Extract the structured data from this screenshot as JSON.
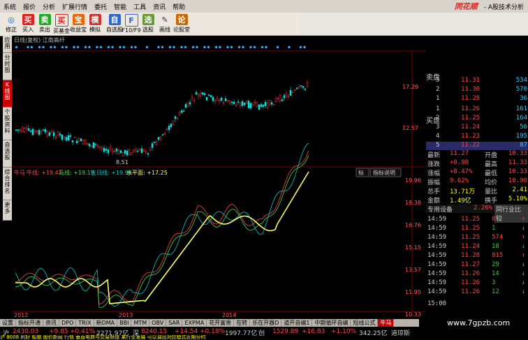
{
  "menu": {
    "items": [
      "系统",
      "报价",
      "分析",
      "扩展行情",
      "委托",
      "智能",
      "工具",
      "资讯",
      "帮助"
    ],
    "brand": "同花顺",
    "brand_sub": "- A股技术分析"
  },
  "toolbar": {
    "items": [
      {
        "label": "修正",
        "icon": "◎"
      },
      {
        "label": "买入",
        "icon": "买"
      },
      {
        "label": "卖出",
        "icon": "卖"
      },
      {
        "label": "买基金",
        "icon": "买"
      },
      {
        "label": "收益宝",
        "icon": "宝"
      },
      {
        "label": "模拟",
        "icon": "模"
      },
      {
        "label": "自选股",
        "icon": "自"
      },
      {
        "label": "F10/F9",
        "icon": "F"
      },
      {
        "label": "选股",
        "icon": "选"
      },
      {
        "label": "画线",
        "icon": "✎"
      },
      {
        "label": "论股堂",
        "icon": "论"
      }
    ]
  },
  "left_tabs": [
    "应用",
    "分时图",
    "K线图",
    "个股资料",
    "自选股",
    "综合排名",
    "更多"
  ],
  "chart": {
    "header": "日线(复权) 江南高纤",
    "price_ticks": [
      "17.29",
      "12.57"
    ],
    "low_label": "8.51",
    "indicator": {
      "name": "牛马",
      "items": [
        {
          "label": "牛线: +19.42",
          "color": "#ff4444"
        },
        {
          "label": "马线: +19.19",
          "color": "#44dd44"
        },
        {
          "label": "五日线: +19.96",
          "color": "#00cccc"
        },
        {
          "label": "水平面: +17.25",
          "color": "#ffff66"
        }
      ],
      "side_buttons": [
        "标",
        "指标说明"
      ],
      "ticks": [
        "19.96",
        "18.38",
        "16.76",
        "15.15",
        "13.57",
        "11.95",
        "10.33"
      ]
    },
    "years": [
      "2012",
      "2013",
      "2014"
    ]
  },
  "quote": {
    "ask": [
      {
        "lvl": "3",
        "price": "11.31",
        "vol": "534"
      },
      {
        "lvl": "2",
        "price": "11.30",
        "vol": "570"
      },
      {
        "lvl": "1",
        "price": "11.28",
        "vol": "36"
      }
    ],
    "bid": [
      {
        "lvl": "1",
        "price": "11.26",
        "vol": "161"
      },
      {
        "lvl": "2",
        "price": "11.25",
        "vol": "164"
      },
      {
        "lvl": "3",
        "price": "11.24",
        "vol": "56"
      },
      {
        "lvl": "4",
        "price": "11.23",
        "vol": "195"
      },
      {
        "lvl": "5",
        "price": "11.22",
        "vol": "87"
      }
    ],
    "side_ask": "卖盘",
    "side_bid": "买盘",
    "stats": [
      {
        "l1": "最新",
        "v1": "11.27",
        "l2": "开盘",
        "v2": "10.33"
      },
      {
        "l1": "涨跌",
        "v1": "+0.88",
        "l2": "最高",
        "v2": "11.33"
      },
      {
        "l1": "涨幅",
        "v1": "+8.47%",
        "l2": "最低",
        "v2": "10.33"
      },
      {
        "l1": "振幅",
        "v1": "9.62%",
        "l2": "均价",
        "v2": "10.90"
      },
      {
        "l1": "总手",
        "v1": "13.71万",
        "l2": "量比",
        "v2": "2.41"
      },
      {
        "l1": "金额",
        "v1": "1.49亿",
        "l2": "换手",
        "v2": "5.10%"
      }
    ],
    "industry": {
      "name": "专用设备",
      "pct": "2.26%",
      "button": "同行业比较"
    },
    "ticks": [
      {
        "time": "14:59",
        "price": "11.25",
        "vol": "8",
        "dir": "up"
      },
      {
        "time": "14:59",
        "price": "11.25",
        "vol": "1",
        "dir": "down"
      },
      {
        "time": "14:59",
        "price": "11.25",
        "vol": "574",
        "dir": "up"
      },
      {
        "time": "14:59",
        "price": "11.24",
        "vol": "18",
        "dir": "down"
      },
      {
        "time": "14:59",
        "price": "11.28",
        "vol": "815",
        "dir": "up"
      },
      {
        "time": "14:59",
        "price": "11.27",
        "vol": "29",
        "dir": "down"
      },
      {
        "time": "14:59",
        "price": "11.26",
        "vol": "14",
        "dir": "down"
      },
      {
        "time": "14:59",
        "price": "11.26",
        "vol": "3",
        "dir": "down"
      },
      {
        "time": "14:59",
        "price": "11.26",
        "vol": "12",
        "dir": "down"
      }
    ],
    "last_time": "15:00"
  },
  "bottom_tabs": [
    "设置",
    "指标开通",
    "资讯",
    "DPO",
    "TRIX",
    "新DMA",
    "BBI",
    "MTM",
    "OBV",
    "SAR",
    "EXPMA",
    "花开富贵",
    "在转",
    "乐在开器D",
    "道开自编1",
    "中期循环自编",
    "短线公式",
    "牛马"
  ],
  "status": {
    "sh_label": "沪",
    "sh_index": "2430.03",
    "sh_change": "+9.85",
    "sh_pct": "+0.41%",
    "sh_amount": "2271.97亿",
    "sz_label": "深",
    "sz_index": "8240.15",
    "sz_change": "+14.54",
    "sz_pct": "+0.18%",
    "sz_amount": "1997.77亿",
    "cy_label": "创",
    "cy_index": "1529.89",
    "cy_change": "+16.83",
    "cy_pct": "+1.10%",
    "dj_amount": "342.25亿",
    "dj_label": "道琼斯"
  },
  "ticker": "沪  8008  利好  船舶  股价新闻  行情  垂直电商与交易频道  某行业发展  可以调出对应模式近期分时",
  "watermark": "www.7gpzb.com"
}
